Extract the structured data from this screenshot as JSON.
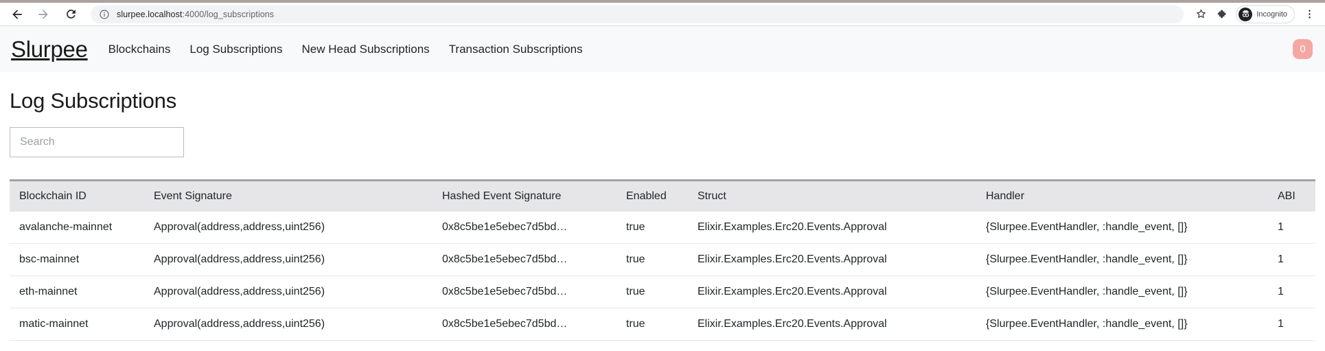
{
  "browser": {
    "back_icon": "back-arrow-icon",
    "forward_icon": "forward-arrow-icon",
    "reload_icon": "reload-icon",
    "site_info_icon": "info-circle-icon",
    "url_host": "slurpee.localhost",
    "url_path": ":4000/log_subscriptions",
    "bookmark_icon": "star-icon",
    "extensions_icon": "puzzle-piece-icon",
    "incognito_label": "Incognito",
    "incognito_icon": "incognito-hat-glasses-icon",
    "menu_icon": "three-dot-menu-icon"
  },
  "app": {
    "brand": "Slurpee",
    "nav_links": [
      {
        "label": "Blockchains"
      },
      {
        "label": "Log Subscriptions"
      },
      {
        "label": "New Head Subscriptions"
      },
      {
        "label": "Transaction Subscriptions"
      }
    ],
    "badge_count": "0",
    "badge_color": "#f6a6a3"
  },
  "page": {
    "title": "Log Subscriptions",
    "search_placeholder": "Search",
    "search_value": ""
  },
  "table": {
    "columns": [
      "Blockchain ID",
      "Event Signature",
      "Hashed Event Signature",
      "Enabled",
      "Struct",
      "Handler",
      "ABI"
    ],
    "rows": [
      {
        "blockchain_id": "avalanche-mainnet",
        "event_signature": "Approval(address,address,uint256)",
        "hashed_event_signature": "0x8c5be1e5ebec7d5bd…",
        "enabled": "true",
        "struct": "Elixir.Examples.Erc20.Events.Approval",
        "handler": "{Slurpee.EventHandler, :handle_event, []}",
        "abi": "1"
      },
      {
        "blockchain_id": "bsc-mainnet",
        "event_signature": "Approval(address,address,uint256)",
        "hashed_event_signature": "0x8c5be1e5ebec7d5bd…",
        "enabled": "true",
        "struct": "Elixir.Examples.Erc20.Events.Approval",
        "handler": "{Slurpee.EventHandler, :handle_event, []}",
        "abi": "1"
      },
      {
        "blockchain_id": "eth-mainnet",
        "event_signature": "Approval(address,address,uint256)",
        "hashed_event_signature": "0x8c5be1e5ebec7d5bd…",
        "enabled": "true",
        "struct": "Elixir.Examples.Erc20.Events.Approval",
        "handler": "{Slurpee.EventHandler, :handle_event, []}",
        "abi": "1"
      },
      {
        "blockchain_id": "matic-mainnet",
        "event_signature": "Approval(address,address,uint256)",
        "hashed_event_signature": "0x8c5be1e5ebec7d5bd…",
        "enabled": "true",
        "struct": "Elixir.Examples.Erc20.Events.Approval",
        "handler": "{Slurpee.EventHandler, :handle_event, []}",
        "abi": "1"
      }
    ]
  }
}
